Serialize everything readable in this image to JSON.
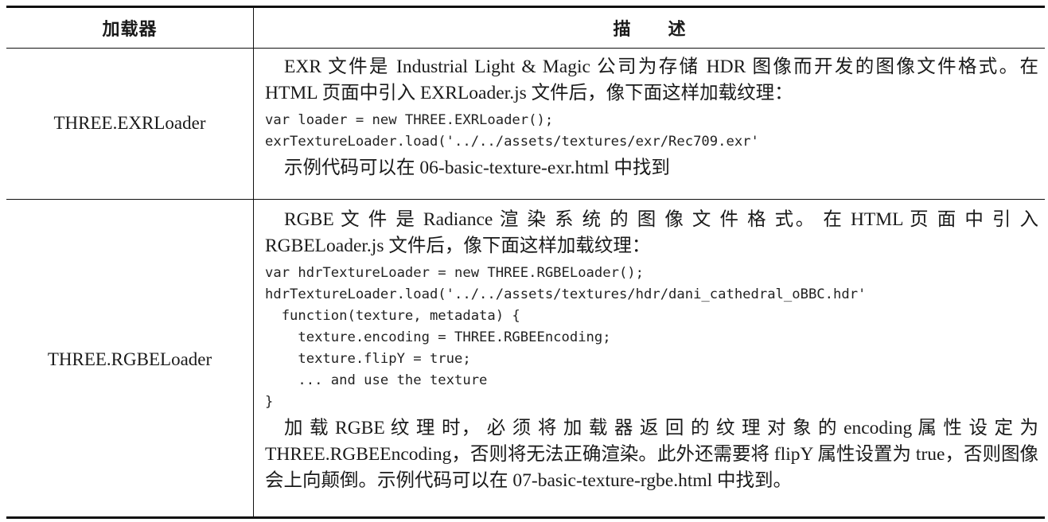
{
  "header": {
    "col_loader": "加载器",
    "col_desc": "描　　述"
  },
  "rows": [
    {
      "loader": "THREE.EXRLoader",
      "intro": "EXR 文件是 Industrial Light & Magic 公司为存储 HDR 图像而开发的图像文件格式。在 HTML 页面中引入 EXRLoader.js 文件后，像下面这样加载纹理：",
      "code": [
        "var loader = new THREE.EXRLoader();",
        "exrTextureLoader.load('../../assets/textures/exr/Rec709.exr'"
      ],
      "note": "示例代码可以在 06-basic-texture-exr.html 中找到"
    },
    {
      "loader": "THREE.RGBELoader",
      "intro": "RGBE 文 件 是 Radiance 渲 染 系 统 的 图 像 文 件 格 式。 在 HTML 页 面 中 引 入 RGBELoader.js 文件后，像下面这样加载纹理：",
      "code": [
        "var hdrTextureLoader = new THREE.RGBELoader();",
        "hdrTextureLoader.load('../../assets/textures/hdr/dani_cathedral_oBBC.hdr'",
        "  function(texture, metadata) {",
        "    texture.encoding = THREE.RGBEEncoding;",
        "    texture.flipY = true;",
        "    ... and use the texture",
        "}"
      ],
      "note": "加 载 RGBE 纹 理 时， 必 须 将 加 载 器 返 回 的 纹 理 对 象 的 encoding 属 性 设 定 为 THREE.RGBEEncoding，否则将无法正确渲染。此外还需要将 flipY 属性设置为 true，否则图像会上向颠倒。示例代码可以在 07-basic-texture-rgbe.html 中找到。"
    }
  ]
}
